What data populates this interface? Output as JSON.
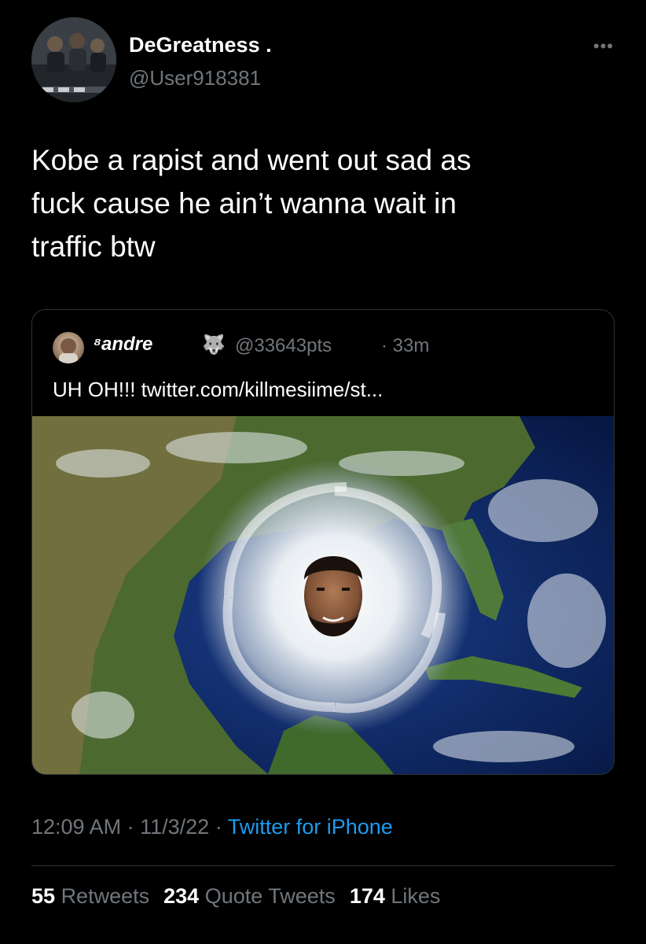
{
  "tweet": {
    "display_name": "DeGreatness .",
    "handle": "@User918381",
    "more_icon": "more-dots-icon",
    "text": "Kobe a rapist and went out sad as\nfuck cause he ain’t wanna wait in\ntraffic btw",
    "time": "12:09 AM",
    "date": "11/3/22",
    "source": "Twitter for iPhone",
    "separator": "·"
  },
  "quoted": {
    "name": "⁸andre",
    "emoji_icon": "wolf-icon",
    "emoji": "🐺",
    "handle": "@33643pts",
    "time": "· 33m",
    "text": "UH OH!!! twitter.com/killmesiime/st...",
    "image": "hurricane-satellite-map-with-face"
  },
  "stats": {
    "retweets_count": "55",
    "retweets_label": "Retweets",
    "quotes_count": "234",
    "quotes_label": "Quote Tweets",
    "likes_count": "174",
    "likes_label": "Likes"
  },
  "colors": {
    "background": "#000000",
    "text": "#ffffff",
    "secondary": "#71767b",
    "link": "#1d9bf0",
    "border": "#2f3336"
  }
}
